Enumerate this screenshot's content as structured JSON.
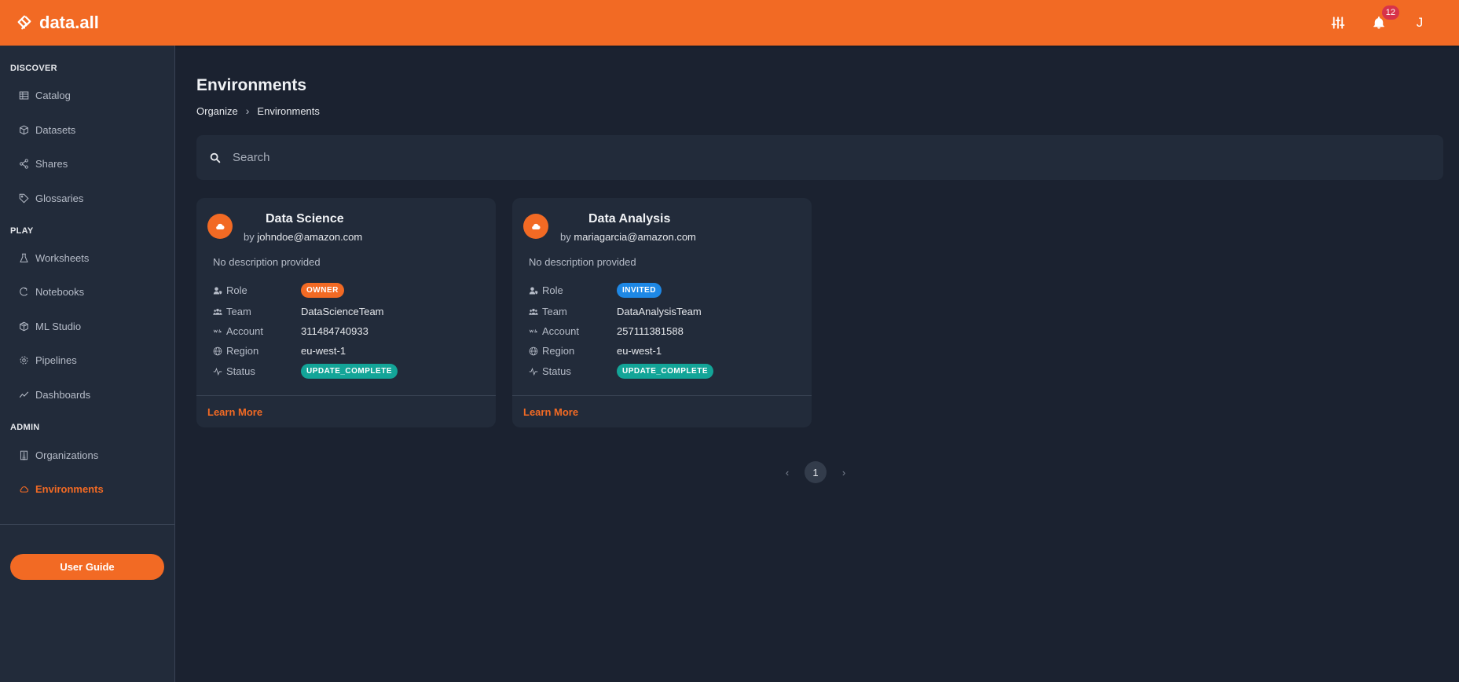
{
  "app": {
    "brand": "data.all"
  },
  "topbar": {
    "notification_count": "12",
    "user_initial": "J"
  },
  "sidebar": {
    "sections": [
      {
        "title": "DISCOVER",
        "items": [
          {
            "label": "Catalog",
            "icon": "table-icon"
          },
          {
            "label": "Datasets",
            "icon": "box-icon"
          },
          {
            "label": "Shares",
            "icon": "share-icon"
          },
          {
            "label": "Glossaries",
            "icon": "tag-icon"
          }
        ]
      },
      {
        "title": "PLAY",
        "items": [
          {
            "label": "Worksheets",
            "icon": "flask-icon"
          },
          {
            "label": "Notebooks",
            "icon": "notebook-icon"
          },
          {
            "label": "ML Studio",
            "icon": "cube-icon"
          },
          {
            "label": "Pipelines",
            "icon": "gear-icon"
          },
          {
            "label": "Dashboards",
            "icon": "chart-line-icon"
          }
        ]
      },
      {
        "title": "ADMIN",
        "items": [
          {
            "label": "Organizations",
            "icon": "building-icon"
          },
          {
            "label": "Environments",
            "icon": "cloud-icon",
            "active": true
          }
        ]
      }
    ],
    "guide_button": "User Guide"
  },
  "main": {
    "title": "Environments",
    "breadcrumb": [
      "Organize",
      "Environments"
    ],
    "search": {
      "placeholder": "Search",
      "value": ""
    },
    "cards": [
      {
        "name": "Data Science",
        "by": "by",
        "owner": "johndoe@amazon.com",
        "description": "No description provided",
        "fields": {
          "role_label": "Role",
          "role": "OWNER",
          "role_color": "#f26a24",
          "team_label": "Team",
          "team": "DataScienceTeam",
          "account_label": "Account",
          "account": "311484740933",
          "region_label": "Region",
          "region": "eu-west-1",
          "status_label": "Status",
          "status": "UPDATE_COMPLETE",
          "status_color": "#13a598"
        },
        "link": "Learn More"
      },
      {
        "name": "Data Analysis",
        "by": "by",
        "owner": "mariagarcia@amazon.com",
        "description": "No description provided",
        "fields": {
          "role_label": "Role",
          "role": "INVITED",
          "role_color": "#1e88e5",
          "team_label": "Team",
          "team": "DataAnalysisTeam",
          "account_label": "Account",
          "account": "257111381588",
          "region_label": "Region",
          "region": "eu-west-1",
          "status_label": "Status",
          "status": "UPDATE_COMPLETE",
          "status_color": "#13a598"
        },
        "link": "Learn More"
      }
    ],
    "pagination": {
      "current_page": "1"
    }
  },
  "colors": {
    "accent": "#f26a24",
    "background": "#1b2230",
    "panel": "#222b3a"
  }
}
